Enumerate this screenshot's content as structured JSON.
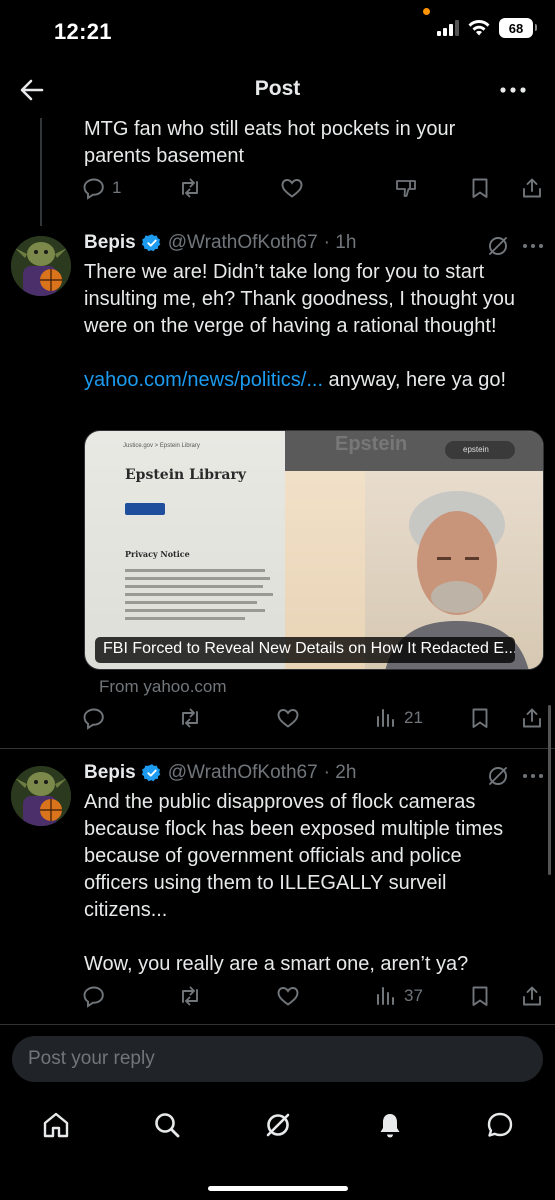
{
  "status_bar": {
    "time": "12:21",
    "battery": "68"
  },
  "header": {
    "title": "Post"
  },
  "prev_tweet": {
    "text": "MTG fan who still eats hot pockets in your parents basement",
    "reply_count": "1"
  },
  "tweet1": {
    "name": "Bepis",
    "handle": "@WrathOfKoth67",
    "time": "· 1h",
    "text": "There we are! Didn’t take long for you to start insulting me, eh? Thank goodness, I thought you were on the verge of having a rational thought!",
    "link_text": "yahoo.com/news/politics/...",
    "after_link": " anyway, here ya go!",
    "card": {
      "caption": "FBI Forced to Reveal New Details on How It Redacted E...",
      "source": "From yahoo.com",
      "left_title": "Epstein Library",
      "left_breadcrumb": "Justice.gov  >  Epstein Library",
      "left_section": "Privacy Notice",
      "right_search": "epstein",
      "right_watermark": "Epstein"
    },
    "views": "21"
  },
  "tweet2": {
    "name": "Bepis",
    "handle": "@WrathOfKoth67",
    "time": "· 2h",
    "text": "And the public disapproves of flock cameras because flock has been exposed multiple times because of government officials and police officers using them to ILLEGALLY surveil citizens...",
    "text2": "Wow, you really are a smart one, aren’t ya?",
    "views": "37"
  },
  "reply": {
    "placeholder": "Post your reply"
  },
  "colors": {
    "accent": "#1d9bf0",
    "muted": "#71767b",
    "text": "#e7e9ea",
    "background": "#000000"
  },
  "icons": [
    "back-arrow-icon",
    "more-icon",
    "reply-icon",
    "repost-icon",
    "like-icon",
    "views-icon",
    "bookmark-icon",
    "share-icon",
    "verified-icon",
    "grok-icon",
    "home-icon",
    "search-icon",
    "notifications-icon",
    "messages-icon"
  ]
}
